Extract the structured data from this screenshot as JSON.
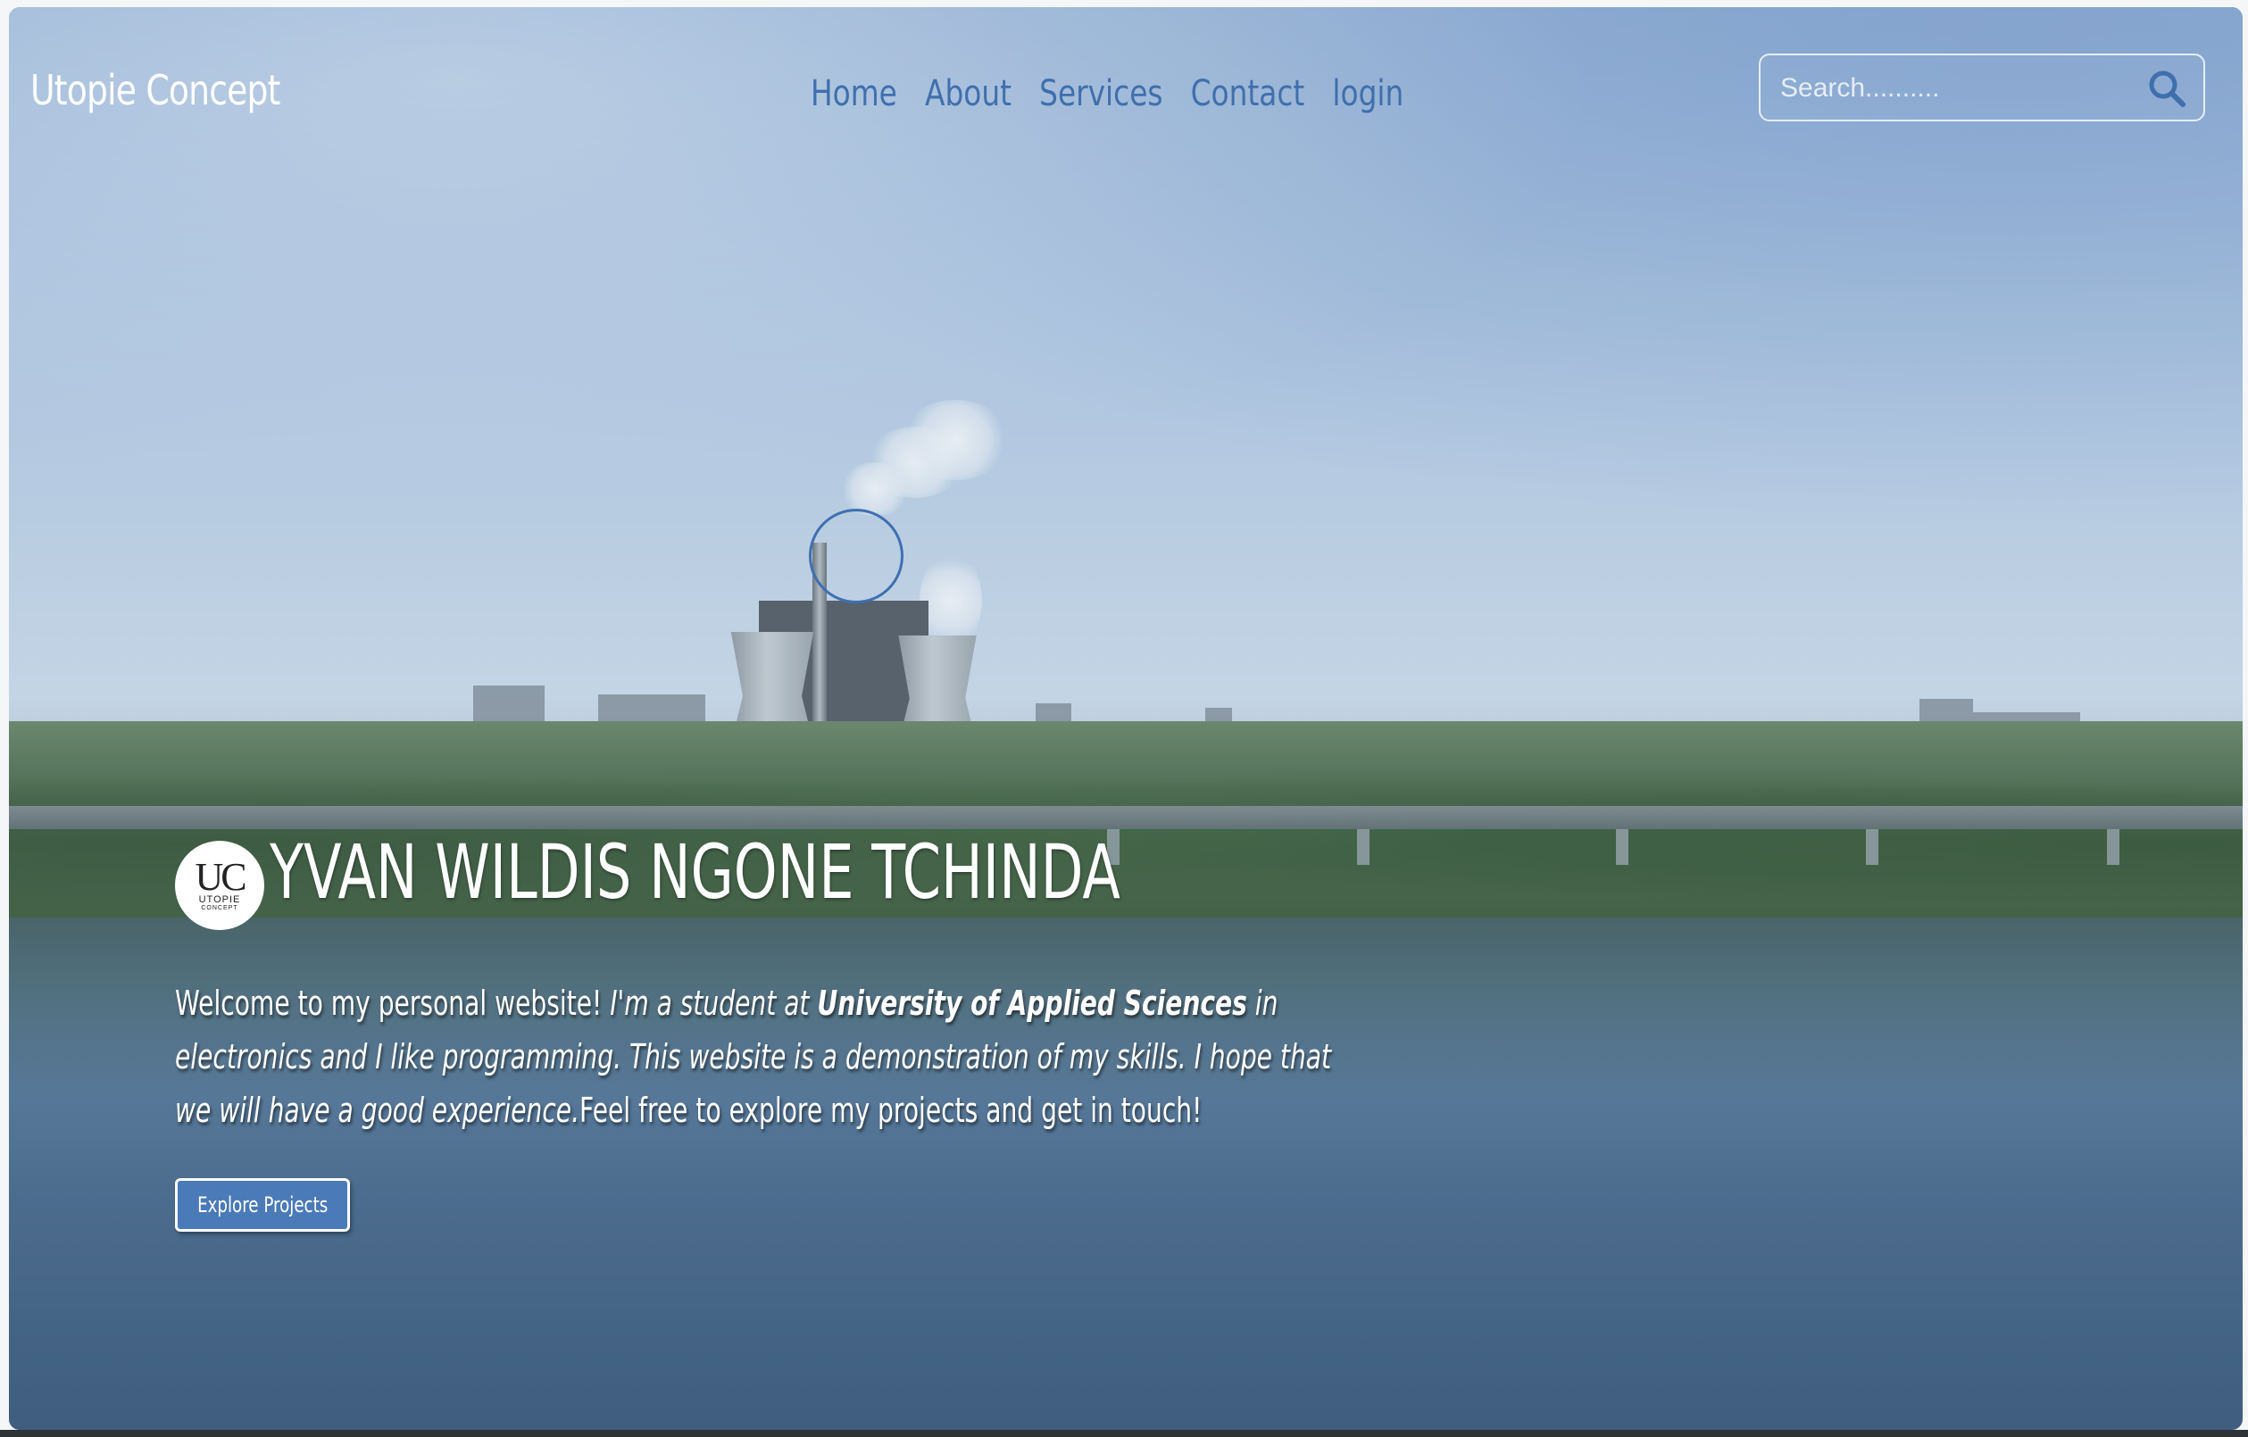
{
  "brand": {
    "name": "Utopie Concept"
  },
  "nav": {
    "items": [
      {
        "label": "Home"
      },
      {
        "label": "About"
      },
      {
        "label": "Services"
      },
      {
        "label": "Contact"
      },
      {
        "label": "login"
      }
    ]
  },
  "search": {
    "placeholder": "Search..........",
    "value": "",
    "icon": "search-icon"
  },
  "hero": {
    "logo": {
      "mark": "UC",
      "text": "UTOPIE",
      "sub": "CONCEPT"
    },
    "name": "YVAN WILDIS NGONE TCHINDA",
    "desc_plain_1": "Welcome to my personal website! ",
    "desc_italic_1": "I'm a student at ",
    "desc_bold": "University of Applied Sciences",
    "desc_italic_2": " in electronics and I like programming. This website is a demonstration of my skills. I hope that we will have a good experience.",
    "desc_plain_2": "Feel free to explore my projects and get in touch!",
    "cta_label": "Explore Projects"
  },
  "colors": {
    "nav_link": "#3f6fad",
    "button_bg": "#4a7ab8",
    "cursor_ring": "#3f6fb0"
  }
}
